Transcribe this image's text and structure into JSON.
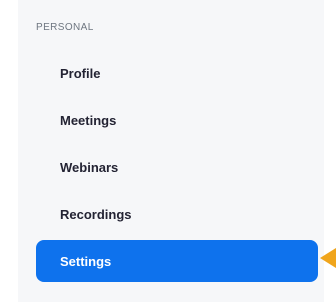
{
  "sidebar": {
    "section_label": "PERSONAL",
    "items": [
      {
        "label": "Profile"
      },
      {
        "label": "Meetings"
      },
      {
        "label": "Webinars"
      },
      {
        "label": "Recordings"
      },
      {
        "label": "Settings",
        "active": true
      }
    ]
  },
  "colors": {
    "accent": "#0e72ed",
    "pointer": "#f0a51c"
  }
}
